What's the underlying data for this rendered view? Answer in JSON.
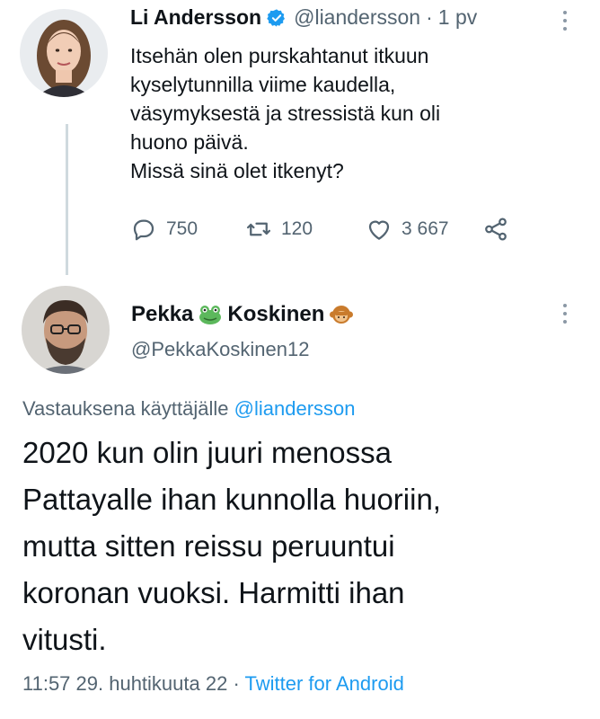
{
  "tweet1": {
    "display_name": "Li Andersson",
    "handle": "@liandersson",
    "separator": "·",
    "time": "1 pv",
    "text_lines": [
      "Itsehän olen purskahtanut itkuun",
      "kyselytunnilla viime kaudella,",
      "väsymyksestä ja stressistä kun oli",
      "huono päivä.",
      "Missä sinä olet itkenyt?"
    ],
    "replies": "750",
    "retweets": "120",
    "likes": "3 667",
    "icons": [
      "reply-icon",
      "retweet-icon",
      "like-icon",
      "share-icon",
      "verified-badge-icon",
      "more-icon"
    ],
    "verified_color": "#1d9bf0"
  },
  "tweet2": {
    "name_part1": "Pekka",
    "name_part2": "Koskinen",
    "handle": "@PekkaKoskinen12",
    "reply_prefix": "Vastauksena käyttäjälle",
    "reply_mention": "@liandersson",
    "text_lines": [
      "2020 kun olin juuri menossa",
      "Pattayalle ihan kunnolla huoriin,",
      "mutta sitten reissu peruuntui",
      "koronan vuoksi. Harmitti ihan",
      "vitusti."
    ],
    "timestamp": "11:57 29. huhtikuuta 22",
    "separator": "·",
    "client": "Twitter for Android",
    "icons": [
      "frog-emoji-icon",
      "monkey-emoji-icon",
      "more-icon"
    ],
    "link_color": "#1d9bf0"
  }
}
